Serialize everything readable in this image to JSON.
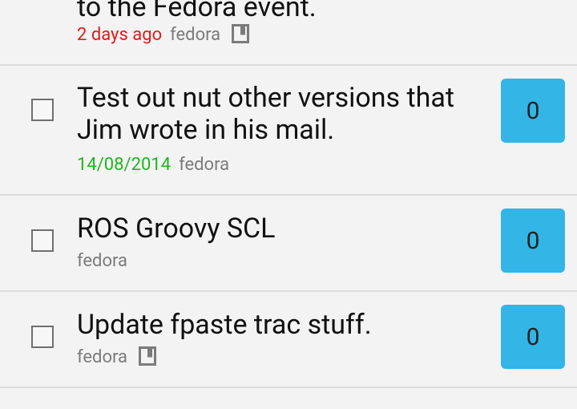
{
  "tasks": [
    {
      "title": "to the Fedora event.",
      "date": "2 days ago",
      "date_color": "#e21b1b",
      "list": "fedora",
      "icon": "note-icon"
    },
    {
      "title": "Test out nut other versions that Jim wrote in his mail.",
      "date": "14/08/2014",
      "date_color": "#1fb51f",
      "list": "fedora",
      "count": "0"
    },
    {
      "title": "ROS Groovy SCL",
      "list": "fedora",
      "count": "0"
    },
    {
      "title": "Update fpaste trac stuff.",
      "list": "fedora",
      "icon": "note-icon",
      "count": "0"
    }
  ]
}
